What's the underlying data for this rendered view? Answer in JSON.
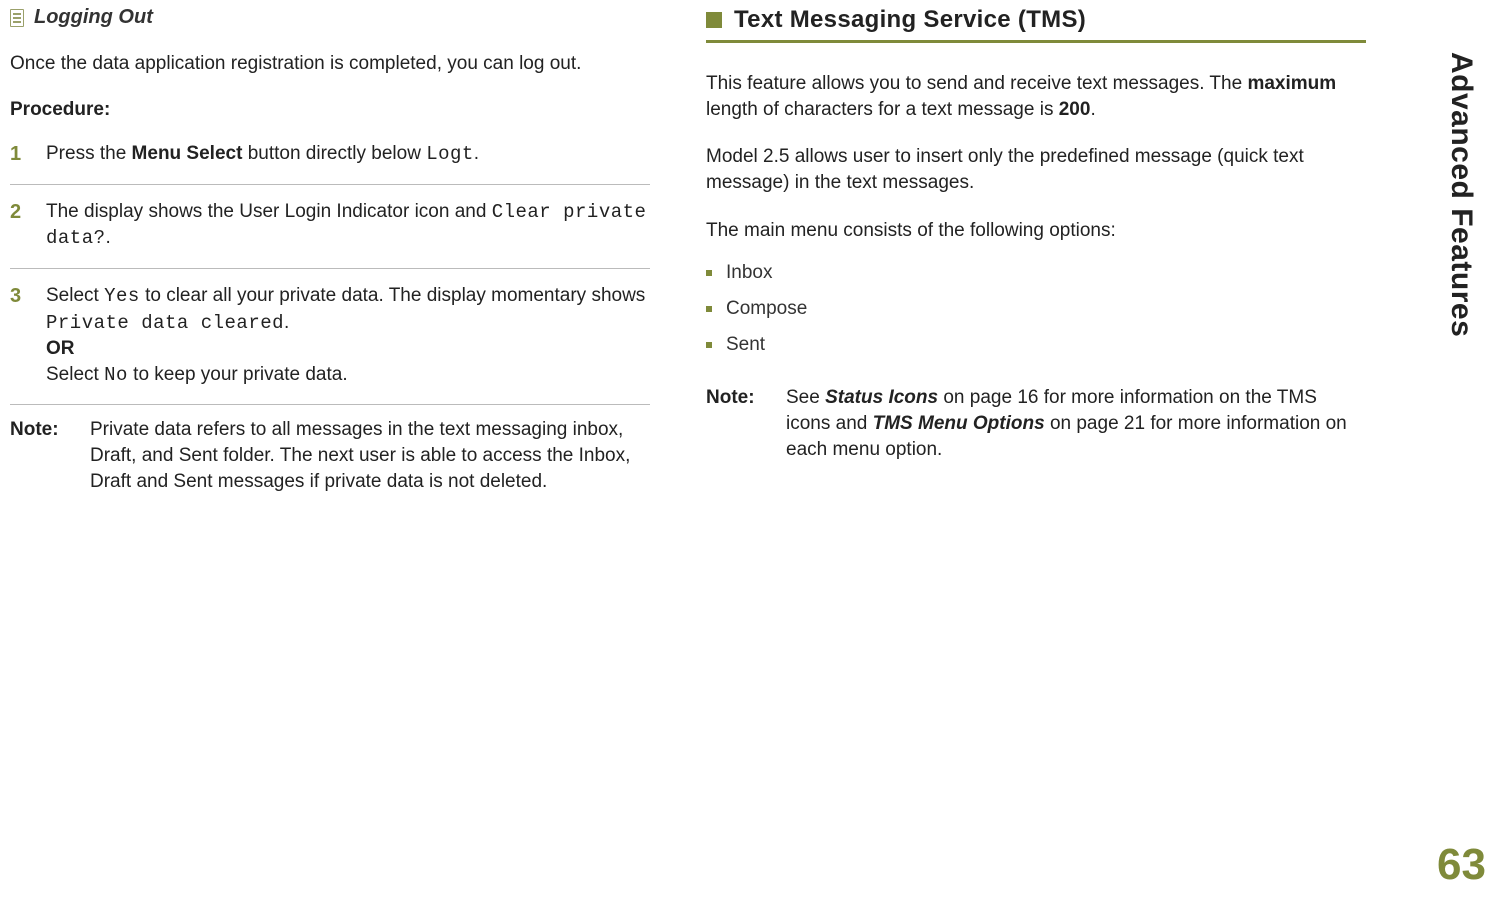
{
  "sideTab": "Advanced Features",
  "pageNumber": "63",
  "left": {
    "subHeading": "Logging Out",
    "intro": "Once the data application registration is completed, you can log out.",
    "procedureLabel": "Procedure:",
    "steps": {
      "s1": {
        "num": "1",
        "pre": "Press the ",
        "bold": "Menu Select",
        "mid": " button directly below ",
        "code": "Logt",
        "post": "."
      },
      "s2": {
        "num": "2",
        "pre": "The display shows the User Login Indicator icon and ",
        "code": "Clear private data?",
        "post": "."
      },
      "s3": {
        "num": "3",
        "a_pre": "Select ",
        "a_code": "Yes",
        "a_mid": " to clear all your private data. The display momentary shows ",
        "a_code2": "Private data cleared",
        "a_post": ".",
        "or": "OR",
        "b_pre": "Select ",
        "b_code": "No",
        "b_post": " to keep your private data."
      }
    },
    "noteLabel": "Note:",
    "noteBody": "Private data refers to all messages in the text messaging inbox, Draft, and Sent folder. The next user is able to access the Inbox, Draft and Sent messages if private data is not deleted."
  },
  "right": {
    "heading": "Text Messaging Service (TMS)",
    "p1_pre": "This feature allows you to send and receive text messages. The ",
    "p1_bold1": "maximum",
    "p1_mid": " length of characters for a text message is ",
    "p1_bold2": "200",
    "p1_post": ".",
    "p2": "Model 2.5 allows user to insert only the predefined message (quick text message) in the text messages.",
    "menuIntro": "The main menu consists of the following options:",
    "menu": {
      "m1": "Inbox",
      "m2": "Compose",
      "m3": "Sent"
    },
    "noteLabel": "Note:",
    "note_pre": "See ",
    "note_bold1": "Status Icons",
    "note_mid1": " on page 16 for more information on the TMS icons and ",
    "note_bold2": "TMS Menu Options",
    "note_mid2": " on page 21 for more information on each menu option."
  }
}
